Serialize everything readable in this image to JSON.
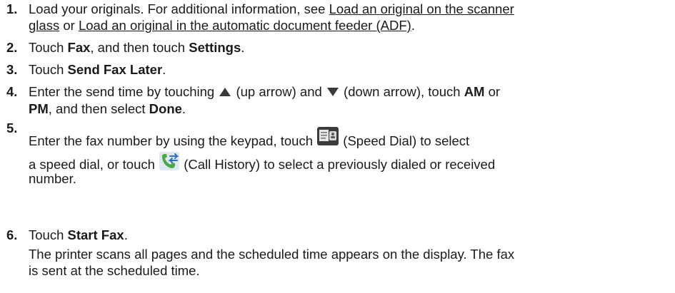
{
  "steps": [
    {
      "number": "1.",
      "lines": [
        {
          "t1": "Load your originals. For additional information, see ",
          "link1": "Load an original on the scanner"
        },
        {
          "link1b": "glass",
          "t2": " or ",
          "link2": "Load an original in the automatic document feeder (ADF)",
          "t3": "."
        }
      ]
    },
    {
      "number": "2.",
      "t1": "Touch ",
      "b1": "Fax",
      "t2": ", and then touch ",
      "b2": "Settings",
      "t3": "."
    },
    {
      "number": "3.",
      "t1": "Touch ",
      "b1": "Send Fax Later",
      "t2": "."
    },
    {
      "number": "4.",
      "line1": {
        "t1": "Enter the send time by touching ",
        "t2": " (up arrow) and ",
        "t3": " (down arrow), touch ",
        "b1": "AM",
        "t4": " or"
      },
      "line2": {
        "b1": "PM",
        "t1": ", and then select ",
        "b2": "Done",
        "t2": "."
      }
    },
    {
      "number": "5.",
      "line1": {
        "t1": "Enter the fax number by using the keypad, touch ",
        "t2": " (Speed Dial) to select"
      },
      "line2": {
        "t1": "a speed dial, or touch ",
        "t2": " (Call History) to select a previously dialed or received"
      },
      "line3": "number."
    },
    {
      "number": "6.",
      "t1": "Touch ",
      "b1": "Start Fax",
      "t2": ".",
      "note1": "The printer scans all pages and the scheduled time appears on the display. The fax",
      "note2": "is sent at the scheduled time."
    }
  ],
  "icons": {
    "up_arrow": "up-arrow-icon",
    "down_arrow": "down-arrow-icon",
    "speed_dial": "speed-dial-icon",
    "call_history": "call-history-icon"
  },
  "colors": {
    "text": "#1a1a1a",
    "icon_dark": "#3a3a3a",
    "speed_dial_bg": "#3c3c3c",
    "call_history_green": "#4aa84a",
    "call_history_blue": "#2f6fc0"
  }
}
